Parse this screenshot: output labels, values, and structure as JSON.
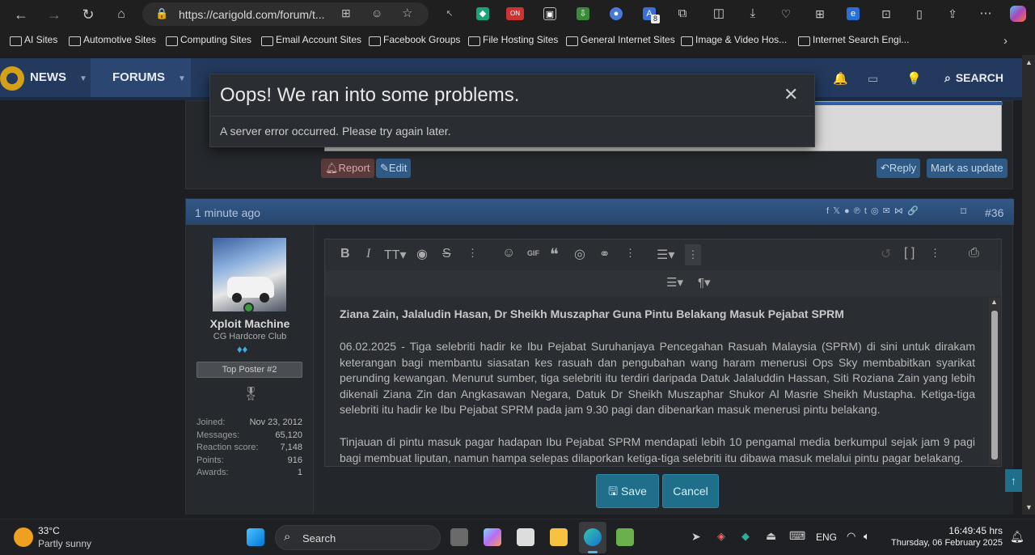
{
  "browser": {
    "url": "https://carigold.com/forum/t...",
    "extension_badge": "ON",
    "extension_badge2": "8",
    "bookmarks": [
      "AI Sites",
      "Automotive Sites",
      "Computing Sites",
      "Email Account Sites",
      "Facebook Groups",
      "File Hosting Sites",
      "General Internet Sites",
      "Image & Video Hos...",
      "Internet Search Engi..."
    ]
  },
  "site_nav": {
    "news": "NEWS",
    "forums": "FORUMS",
    "search": "SEARCH"
  },
  "previous_post": {
    "report": "Report",
    "edit": "Edit",
    "reply": "Reply",
    "mark_update": "Mark as update"
  },
  "modal": {
    "title": "Oops! We ran into some problems.",
    "message": "A server error occurred. Please try again later.",
    "close": "✕"
  },
  "post": {
    "time": "1 minute ago",
    "number": "#36",
    "share_icons": "f  𝕏  ● ℗ t ◎ ✉ ⋈ 🔗"
  },
  "user": {
    "name": "Xploit Machine",
    "title": "CG Hardcore Club",
    "banner": "Top Poster #2",
    "stats": [
      {
        "label": "Joined:",
        "value": "Nov 23, 2012"
      },
      {
        "label": "Messages:",
        "value": "65,120"
      },
      {
        "label": "Reaction score:",
        "value": "7,148"
      },
      {
        "label": "Points:",
        "value": "916"
      },
      {
        "label": "Awards:",
        "value": "1"
      }
    ]
  },
  "editor": {
    "heading": "Ziana Zain, Jalaludin Hasan, Dr Sheikh Muszaphar Guna Pintu Belakang Masuk Pejabat SPRM",
    "paragraph1": "06.02.2025 - Tiga selebriti hadir ke Ibu Pejabat Suruhanjaya Pencegahan Rasuah Malaysia (SPRM) di sini untuk dirakam keterangan bagi membantu siasatan kes rasuah dan pengubahan wang haram menerusi Ops Sky membabitkan syarikat perunding kewangan. Menurut sumber, tiga selebriti itu terdiri daripada Datuk Jalaluddin Hassan, Siti Roziana Zain yang lebih dikenali Ziana Zin dan Angkasawan Negara, Datuk Dr Sheikh Muszaphar Shukor Al Masrie Sheikh Mustapha. Ketiga-tiga selebriti itu hadir ke Ibu Pejabat SPRM pada jam 9.30 pagi dan dibenarkan masuk menerusi pintu belakang.",
    "paragraph2": "Tinjauan di pintu masuk pagar hadapan Ibu Pejabat SPRM mendapati lebih 10 pengamal media berkumpul sejak jam 9 pagi bagi membuat liputan, namun hampa selepas dilaporkan ketiga-tiga selebriti itu dibawa masuk melalui pintu pagar belakang.",
    "save": "Save",
    "cancel": "Cancel"
  },
  "taskbar": {
    "temp": "33°C",
    "weather": "Partly sunny",
    "search": "Search",
    "lang": "ENG",
    "time": "16:49:45 hrs",
    "date": "Thursday, 06 February 2025"
  },
  "colors": {
    "nav_blue": "#23395d",
    "post_header": "#2e4d78",
    "accent_teal": "#1f6f8b",
    "report_red": "#5a3a3a",
    "button_blue": "#2f5a86"
  }
}
